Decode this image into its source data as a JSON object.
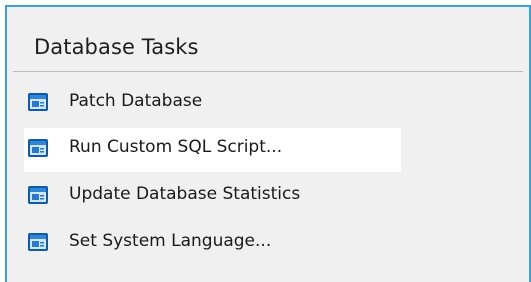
{
  "panel": {
    "title": "Database Tasks",
    "accent_color": "#3c9fd8",
    "background_color": "#f0f0f0"
  },
  "tasks": [
    {
      "label": "Patch Database",
      "icon": "database-task-icon",
      "highlighted": false
    },
    {
      "label": "Run Custom SQL Script...",
      "icon": "database-task-icon",
      "highlighted": true
    },
    {
      "label": "Update Database Statistics",
      "icon": "database-task-icon",
      "highlighted": false
    },
    {
      "label": "Set System Language...",
      "icon": "database-task-icon",
      "highlighted": false
    }
  ]
}
